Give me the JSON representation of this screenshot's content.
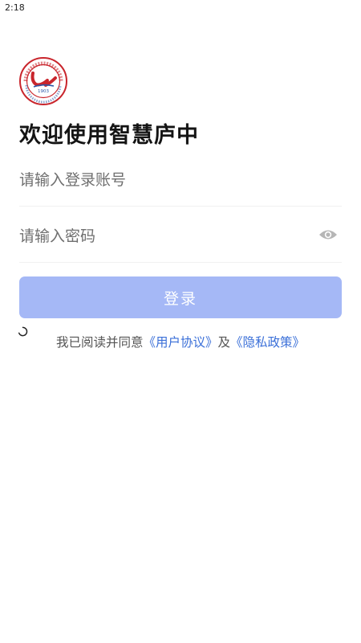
{
  "status_bar": {
    "time": "2:18"
  },
  "logo": {
    "icon": "school-crest-logo",
    "ring_text": "安徽省庐江中学",
    "year": "1903",
    "accent_color": "#c9252c",
    "blue_color": "#2a56a6"
  },
  "header": {
    "title": "欢迎使用智慧庐中"
  },
  "form": {
    "account_placeholder": "请输入登录账号",
    "password_placeholder": "请输入密码",
    "password_toggle_icon": "eye-icon",
    "login_label": "登录",
    "login_color": "#a5b8f6"
  },
  "agreement": {
    "prefix": "我已阅读并同意",
    "user_agreement": "《用户协议》",
    "connector": "及",
    "privacy_policy": "《隐私政策》",
    "link_color": "#3a6fd8"
  }
}
